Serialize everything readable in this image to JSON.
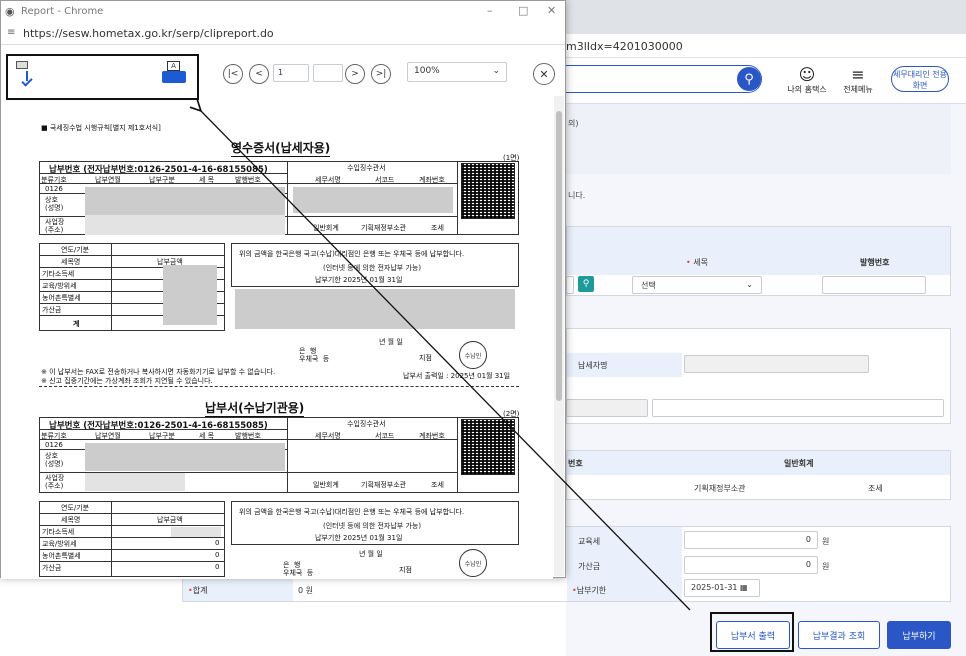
{
  "popup": {
    "window_title": "Report - Chrome",
    "url": "https://sesw.hometax.go.kr/serp/clipreport.do",
    "toolbar": {
      "page_current": "1",
      "page_total": "/1",
      "zoom": "100%"
    }
  },
  "bg": {
    "url_suffix": "m3lIdx=4201030000",
    "header": {
      "my_hometax": "나의 홈택스",
      "all_menu": "전체메뉴",
      "tax_agent": "세무대리인 전용화면"
    },
    "note1": "의)",
    "note2": "니다.",
    "tax_item_label": "세목",
    "issue_no_label": "발행번호",
    "select_placeholder": "선택",
    "taxpayer_name_label": "납세자명",
    "number_label": "번호",
    "general_account_label": "일반회계",
    "ministry": "기획재정부소관",
    "tax_type": "조세",
    "education_tax_label": "교육세",
    "education_tax_value": "0",
    "surtax_label": "가산금",
    "surtax_value": "0",
    "won": "원",
    "total_label": "합계",
    "total_value": "0 원",
    "due_label": "납부기한",
    "due_value": "2025-01-31",
    "buttons": {
      "print": "납부서 출력",
      "result": "납부결과 조회",
      "pay": "납부하기"
    }
  },
  "doc": {
    "rule": "■ 국세징수법 시행규칙[별지 제1호서식]",
    "receipt_title": "영수증서(납세자용)",
    "page1": "(1면)",
    "pay_no": "납부번호 (전자납부번호:0126-2501-4-16-68155085)",
    "collector": "수입징수관서",
    "col_class": "분류기호",
    "col_year": "납부연월",
    "col_type": "납부구분",
    "col_item": "세 목",
    "col_issue": "발행번호",
    "col_office": "세무서명",
    "col_code": "서코드",
    "col_acct": "계좌번호",
    "class_code": "0126",
    "name": "상호\n(성명)",
    "addr": "사업장\n(주소)",
    "general": "일반회계",
    "ministry": "기획재정부소관",
    "tax": "조세",
    "year_base": "연도/기분",
    "item_name": "세목명",
    "amount": "납부금액",
    "row_other": "기타소득세",
    "row_edu": "교육/방위세",
    "row_rural": "농어촌특별세",
    "row_add": "가산금",
    "row_total": "계",
    "notice": "위의 금액을 한국은행 국고(수납)대리점인 은행 또는 우체국 등에 납부합니다.",
    "internet": "(인터넷 등에 의한 전자납부 가능)",
    "due": "납부기한  2025년 01월 31일",
    "date": "년  월  일",
    "bank": "은  행\n우체국  등",
    "branch": "지점",
    "stamp": "수납인",
    "fax": "※ 이 납부서는 FAX로 전송하거나 복사하시면 자동화기기로 납부할 수 없습니다.",
    "period": "※ 신고 집중기간에는 가상계좌 조회가 지연될 수 있습니다.",
    "printed": "납부서 출력일 : 2025년 01월 31일",
    "slip_title": "납부서(수납기관용)",
    "page2": "(2면)",
    "pay_no2": "납부번호 (전자납부번호:0126-2501-4-16-68155085)",
    "zero": "0"
  }
}
